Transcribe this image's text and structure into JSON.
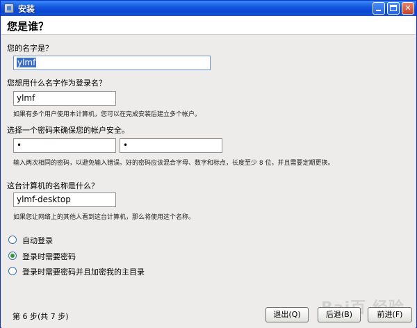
{
  "window": {
    "title": "安装",
    "controls": {
      "minimize": "minimize",
      "maximize": "maximize",
      "close": "✕"
    }
  },
  "page": {
    "title": "您是谁？"
  },
  "form": {
    "name_label": "您的名字是？",
    "name_value": "ylmf",
    "login_label": "您想用什么名字作为登录名？",
    "login_value": "ylmf",
    "login_hint": "如果有多个用户使用本计算机，您可以在完成安装后建立多个帐户。",
    "password_label": "选择一个密码来确保您的帐户安全。",
    "password_value": "•",
    "password_confirm_value": "•",
    "password_hint": "输入两次相同的密码，以避免输入错误。好的密码应该混合字母、数字和标点，长度至少 8 位，并且需要定期更换。",
    "computer_label": "这台计算机的名称是什么？",
    "computer_value": "ylmf-desktop",
    "computer_hint": "如果您让网络上的其他人看到这台计算机，那么将使用这个名称。"
  },
  "login_options": [
    {
      "label": "自动登录",
      "checked": false
    },
    {
      "label": "登录时需要密码",
      "checked": true
    },
    {
      "label": "登录时需要密码并且加密我的主目录",
      "checked": false
    }
  ],
  "footer": {
    "step": "第 6 步(共 7 步)",
    "quit": "退出(Q)",
    "back": "后退(B)",
    "next": "前进(F)"
  },
  "watermark": "Bai百 经验",
  "colors": {
    "titlebar": "#1459e0",
    "selection": "#3c6ec8",
    "radio_checked": "#2f9a2f",
    "background": "#edeceb"
  }
}
